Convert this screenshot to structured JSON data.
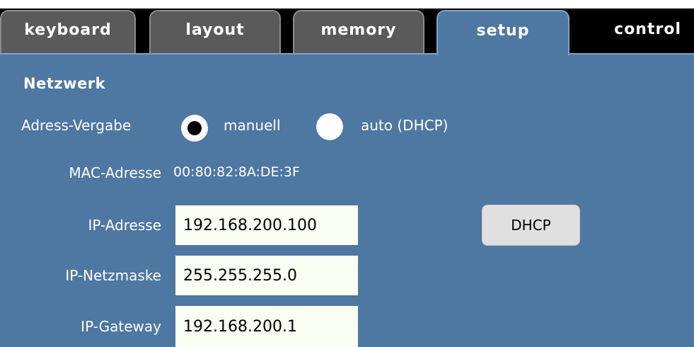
{
  "tabs": [
    {
      "label": "keyboard"
    },
    {
      "label": "layout"
    },
    {
      "label": "memory"
    },
    {
      "label": "setup"
    },
    {
      "label": "control"
    }
  ],
  "active_tab": "setup",
  "section": {
    "title": "Netzwerk"
  },
  "address_mode": {
    "label": "Adress-Vergabe",
    "options": [
      {
        "label": "manuell",
        "selected": true
      },
      {
        "label": "auto (DHCP)",
        "selected": false
      }
    ]
  },
  "mac": {
    "label": "MAC-Adresse",
    "value": "00:80:82:8A:DE:3F"
  },
  "ip_address": {
    "label": "IP-Adresse",
    "value": "192.168.200.100"
  },
  "netmask": {
    "label": "IP-Netzmaske",
    "value": "255.255.255.0"
  },
  "gateway": {
    "label": "IP-Gateway",
    "value": "192.168.200.1"
  },
  "dhcp_button": {
    "label": "DHCP"
  },
  "colors": {
    "panel": "#4e77a2",
    "tab_inactive": "#5a5a5a",
    "tab_bar": "#000000",
    "field_bg": "#fafff4"
  }
}
